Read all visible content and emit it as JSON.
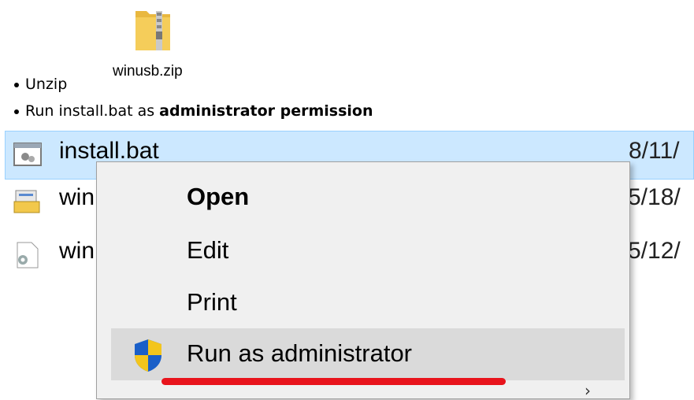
{
  "file_icon": {
    "label": "winusb.zip"
  },
  "instructions": {
    "step1": "Unzip",
    "step2_prefix": "Run install.bat as ",
    "step2_bold": "administrator permission"
  },
  "explorer": {
    "rows": [
      {
        "name": "install.bat",
        "date": "8/11/"
      },
      {
        "name": "win",
        "date": "5/18/"
      },
      {
        "name": "win",
        "date": "5/12/"
      }
    ]
  },
  "context_menu": {
    "items": [
      "Open",
      "Edit",
      "Print",
      "Run as administrator"
    ]
  },
  "colors": {
    "selection": "#cce8ff",
    "highlight": "#dadada",
    "underline": "#e8141c"
  }
}
